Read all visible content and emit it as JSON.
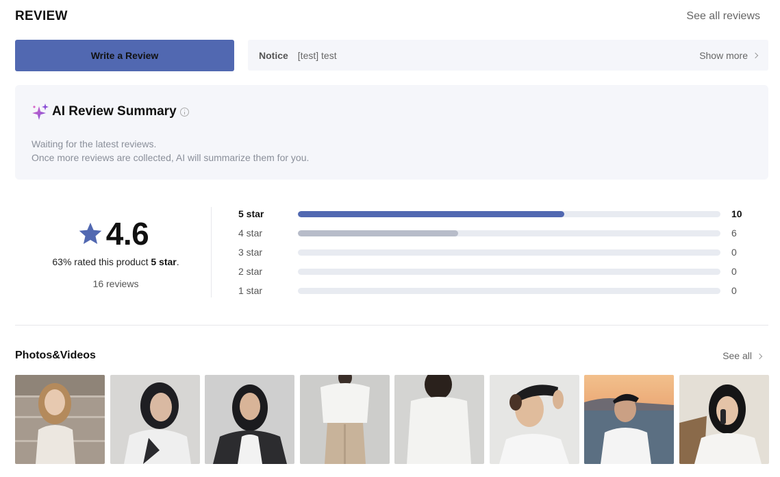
{
  "header": {
    "title": "REVIEW",
    "see_all_reviews": "See all reviews"
  },
  "write_button": {
    "label": "Write a Review"
  },
  "notice": {
    "label": "Notice",
    "text": "[test] test",
    "show_more": "Show more"
  },
  "ai_summary": {
    "title": "AI Review Summary",
    "line1": "Waiting for the latest reviews.",
    "line2": "Once more reviews are collected, AI will summarize them for you."
  },
  "rating": {
    "score": "4.6",
    "rated_prefix": "63% rated this product ",
    "rated_bold": "5 star",
    "rated_suffix": ".",
    "reviews_count": "16 reviews",
    "distribution": [
      {
        "label": "5 star",
        "count": "10",
        "fraction": 0.63,
        "color": "#5168b1"
      },
      {
        "label": "4 star",
        "count": "6",
        "fraction": 0.38,
        "color": "#b7bcc9"
      },
      {
        "label": "3 star",
        "count": "0",
        "fraction": 0,
        "color": "#b7bcc9"
      },
      {
        "label": "2 star",
        "count": "0",
        "fraction": 0,
        "color": "#b7bcc9"
      },
      {
        "label": "1 star",
        "count": "0",
        "fraction": 0,
        "color": "#b7bcc9"
      }
    ]
  },
  "photos": {
    "title": "Photos&Videos",
    "see_all": "See all"
  },
  "colors": {
    "accent": "#5168b1",
    "panel": "#f5f6fa",
    "sparkle_purple": "#8b4fd6",
    "sparkle_pink": "#d868c8"
  }
}
